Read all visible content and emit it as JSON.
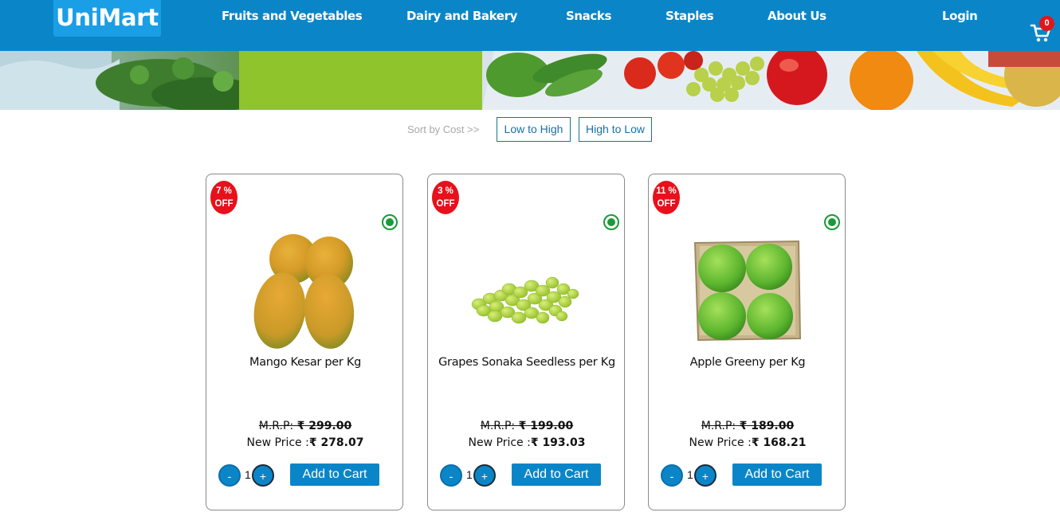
{
  "header": {
    "brand": "UniMart",
    "nav": [
      {
        "label": "Fruits and Vegetables"
      },
      {
        "label": "Dairy and Bakery"
      },
      {
        "label": "Snacks"
      },
      {
        "label": "Staples"
      },
      {
        "label": "About Us"
      }
    ],
    "login": "Login",
    "cart_count": "0",
    "cart_icon": "cart-icon"
  },
  "sort": {
    "label": "Sort by Cost >>",
    "low_to_high": "Low to High",
    "high_to_low": "High to Low"
  },
  "colors": {
    "primary": "#0a86c8",
    "discount": "#e8101a",
    "veg": "#1a9a3a"
  },
  "products": [
    {
      "discount_line1": "7 %",
      "discount_line2": "OFF",
      "name": "Mango Kesar per Kg",
      "mrp_label": "M.R.P:",
      "mrp": "₹ 299.00",
      "new_price_label": "New Price :",
      "new_price": "₹ 278.07",
      "qty": "1",
      "minus": "-",
      "plus": "+",
      "add": "Add to Cart",
      "icon": "mango-image"
    },
    {
      "discount_line1": "3 %",
      "discount_line2": "OFF",
      "name": "Grapes Sonaka Seedless per Kg",
      "mrp_label": "M.R.P:",
      "mrp": "₹ 199.00",
      "new_price_label": "New Price :",
      "new_price": "₹ 193.03",
      "qty": "1",
      "minus": "-",
      "plus": "+",
      "add": "Add to Cart",
      "icon": "grapes-image"
    },
    {
      "discount_line1": "11 %",
      "discount_line2": "OFF",
      "name": "Apple Greeny per Kg",
      "mrp_label": "M.R.P:",
      "mrp": "₹ 189.00",
      "new_price_label": "New Price :",
      "new_price": "₹ 168.21",
      "qty": "1",
      "minus": "-",
      "plus": "+",
      "add": "Add to Cart",
      "icon": "green-apple-image"
    }
  ]
}
